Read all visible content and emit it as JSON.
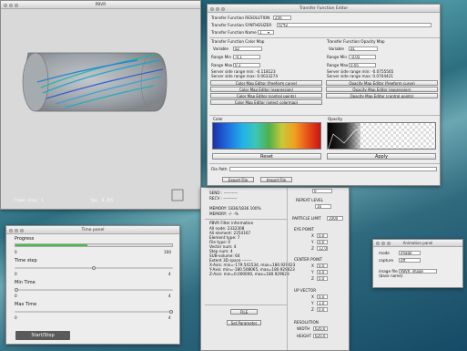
{
  "pbvr": {
    "title": "PBVR",
    "status_left": "Frame step: 1",
    "status_right": "fps: 8.355"
  },
  "tfe": {
    "title": "Transfer Function Editor",
    "resolution_label": "Transfer Function RESOLUTION",
    "resolution_value": "256",
    "synthesizer_label": "Transfer Function SYNTHESIZER",
    "synthesizer_value": "t1*t2",
    "name_label": "Transfer Function Name",
    "name_value": "1",
    "color_map": {
      "header": "Transfer Function Color Map",
      "variable_label": "Variable",
      "variable_value": "q2",
      "range_min_label": "Range Min",
      "range_min_value": "-0.1",
      "range_max_label": "Range Max",
      "range_max_value": "0.1",
      "server_min": "Server side range min: -0.118123",
      "server_max": "Server side range max: 0.0033274",
      "buttons": [
        "Color Map Editor (freeform curve)",
        "Color Map Editor (expression)",
        "Color Map Editor (control points)",
        "Color Map Editor (select colormap)"
      ]
    },
    "opacity_map": {
      "header": "Transfer Function Opacity Map",
      "variable_label": "Variable",
      "variable_value": "q1",
      "range_min_label": "Range Min",
      "range_min_value": "-0.05",
      "range_max_label": "Range Max",
      "range_max_value": "0.05",
      "server_min": "Server side range min: -0.0755565",
      "server_max": "Server side range max: 0.0704421",
      "buttons": [
        "Opacity Map Editor (freeform curve)",
        "Opacity Map Editor (expression)",
        "Opacity Map Editor (control points)"
      ]
    },
    "color_label": "Color",
    "opacity_label": "Opacity",
    "reset": "Reset",
    "apply": "Apply",
    "file_path_label": "File Path",
    "export": "Export File",
    "import": "Import File"
  },
  "main_panel": {
    "top_field": "0",
    "send_line": "SEND : ----------",
    "recv_line": "RECV : ----------",
    "memory": "MEMORY: 1836/1836 100%",
    "memory2": "MEMORY: -/- -%",
    "info_header": "PBVR Filter information",
    "info": [
      "All node: 2332308",
      "All element: 2254167",
      "Element type: 7",
      "File type: 0",
      "Vector num: 4",
      "Step num: 4",
      "SUB-volume: 64",
      "Extent 3D space -------",
      "X-Axis: min=-179.541534, max=180.929623",
      "Y-Axis: min=-180.508065, max=180.929623",
      "Z-Axis: min=0.000000, max=180.929623"
    ],
    "file_btn": "FILE",
    "set_param_btn": "Set Parameter",
    "repeat_level_label": "REPEAT LEVEL",
    "repeat_level_value": "16",
    "particle_limit_label": "PARTICLE LIMIT",
    "particle_limit_value": "1000",
    "eye_point_label": "EYE POINT",
    "eye_x": "0.0",
    "eye_y": "0.0",
    "eye_z": "12.0",
    "center_point_label": "CENTER POINT",
    "center_x": "0.0",
    "center_y": "0.0",
    "center_z": "0.0",
    "up_vector_label": "UP VECTOR",
    "up_x": "0.0",
    "up_y": "1.0",
    "up_z": "0.0",
    "resolution_label": "RESOLUTION",
    "width_label": "WIDTH",
    "width_value": "620.0",
    "height_label": "HEIGHT",
    "height_value": "620.0",
    "axis_x": "X",
    "axis_y": "Y",
    "axis_z": "Z"
  },
  "time_panel": {
    "title": "Time panel",
    "progress_label": "Progress",
    "progress_min": "0",
    "progress_max": "100",
    "progress_fraction": 0.46,
    "time_step_label": "Time step",
    "time_step_min": "0",
    "time_step_max": "4",
    "time_step_fraction": 0.5,
    "min_time_label": "Min Time",
    "min_time_min": "0",
    "min_time_max": "4",
    "min_time_fraction": 0.0,
    "max_time_label": "Max Time",
    "max_time_min": "0",
    "max_time_max": "4",
    "max_time_fraction": 1.0,
    "start_stop": "Start/Stop"
  },
  "animation": {
    "title": "Animation panel",
    "mode_label": "mode",
    "mode_value": "image",
    "capture_label": "capture",
    "capture_value": "off",
    "image_file_label": "image file",
    "base_name_label": "(base name)",
    "image_file_value": "PBVR_image"
  }
}
